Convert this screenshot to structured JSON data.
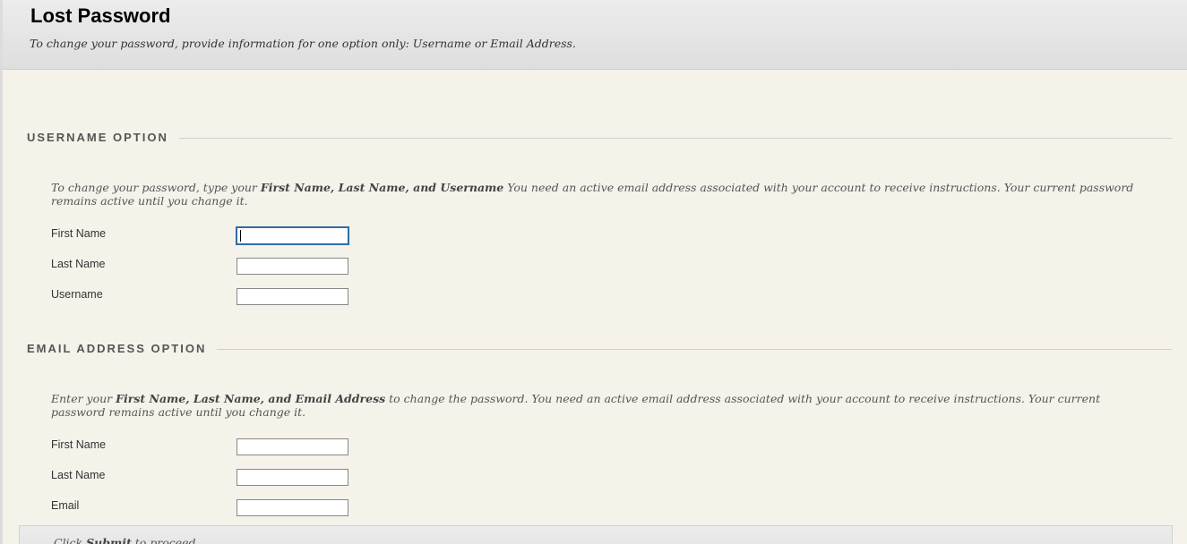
{
  "header": {
    "title": "Lost Password",
    "subtitle": "To change your password, provide information for one option only: Username or Email Address."
  },
  "username_option": {
    "heading": "USERNAME OPTION",
    "instructions_prefix": "To change your password, type your ",
    "instructions_bold": "First Name, Last Name, and Username",
    "instructions_suffix": " You need an active email address associated with your account to receive instructions. Your current password remains active until you change it.",
    "fields": [
      {
        "label": "First Name",
        "value": ""
      },
      {
        "label": "Last Name",
        "value": ""
      },
      {
        "label": "Username",
        "value": ""
      }
    ]
  },
  "email_option": {
    "heading": "EMAIL ADDRESS OPTION",
    "instructions_prefix": "Enter your ",
    "instructions_bold": "First Name, Last Name, and Email Address",
    "instructions_suffix": " to change the password. You need an active email address associated with your account to receive instructions. Your current password remains active until you change it.",
    "fields": [
      {
        "label": "First Name",
        "value": ""
      },
      {
        "label": "Last Name",
        "value": ""
      },
      {
        "label": "Email",
        "value": ""
      }
    ]
  },
  "submit": {
    "prefix": "Click ",
    "bold": "Submit",
    "suffix": " to proceed."
  }
}
